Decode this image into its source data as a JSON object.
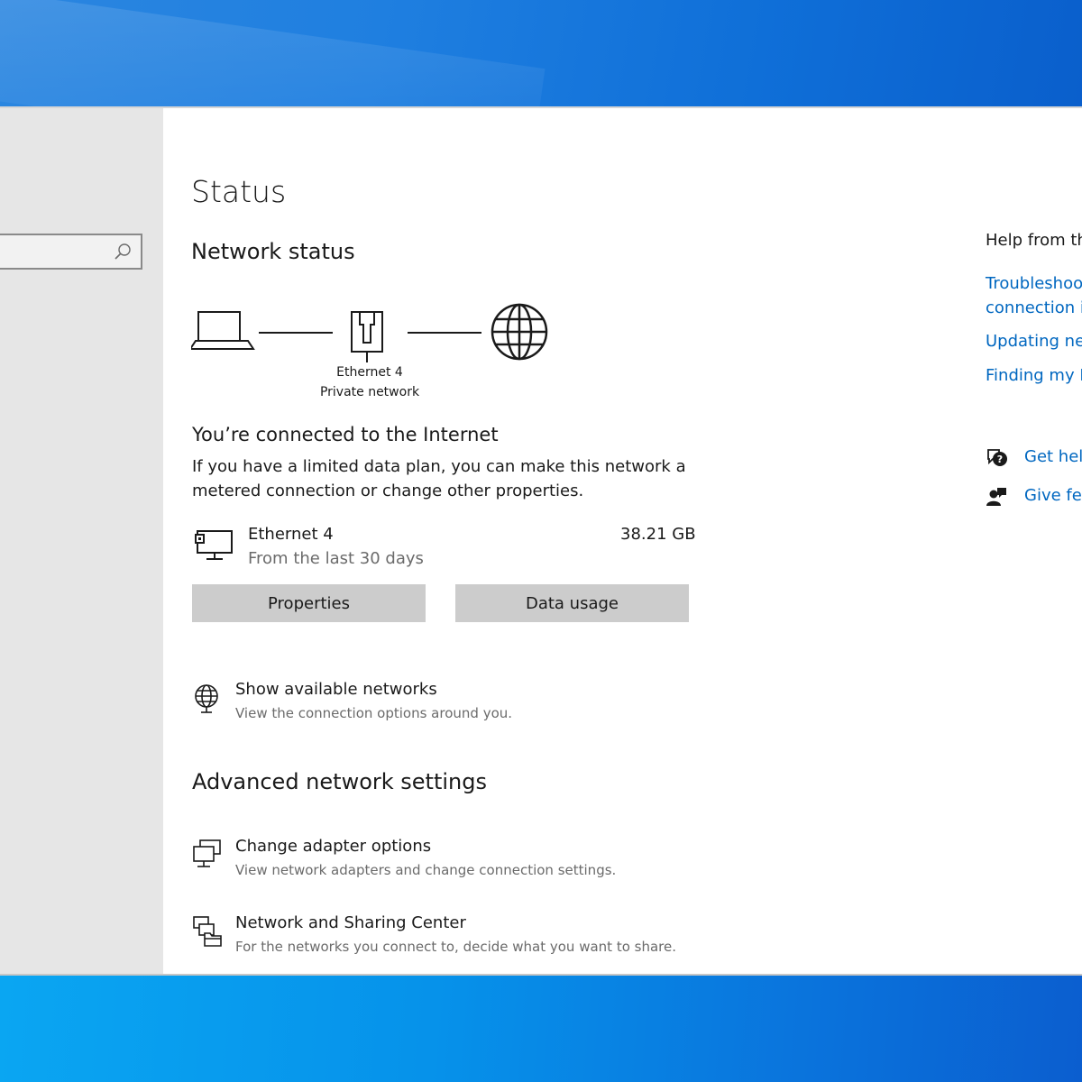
{
  "search": {
    "placeholder": ""
  },
  "page": {
    "title": "Status"
  },
  "network_status": {
    "heading": "Network status",
    "adapter_name": "Ethernet 4",
    "network_type": "Private network",
    "connected_title": "You’re connected to the Internet",
    "connected_desc_line1": "If you have a limited data plan, you can make this network a",
    "connected_desc_line2": "metered connection or change other properties.",
    "usage": {
      "name": "Ethernet 4",
      "period": "From the last 30 days",
      "amount": "38.21 GB"
    },
    "buttons": {
      "properties": "Properties",
      "data_usage": "Data usage"
    }
  },
  "show_networks": {
    "title": "Show available networks",
    "desc": "View the connection options around you."
  },
  "advanced": {
    "heading": "Advanced network settings",
    "items": [
      {
        "title": "Change adapter options",
        "desc": "View network adapters and change connection settings."
      },
      {
        "title": "Network and Sharing Center",
        "desc": "For the networks you connect to, decide what you want to share."
      }
    ]
  },
  "help": {
    "heading": "Help from th",
    "links": [
      "Troubleshoo",
      "connection i",
      "Updating ne",
      "Finding my I"
    ],
    "get_help": "Get hel",
    "give_feedback": "Give fe"
  },
  "colors": {
    "link": "#0067c0",
    "button": "#cccccc",
    "sidebar": "#e6e6e6"
  }
}
